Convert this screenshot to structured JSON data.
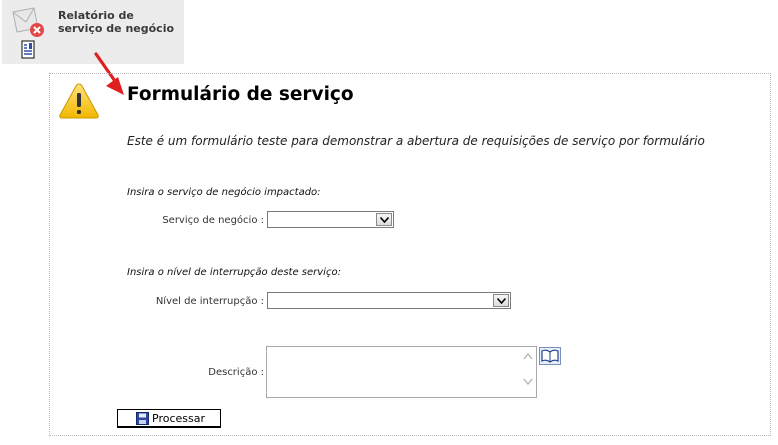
{
  "report": {
    "title": "Relatório de serviço de negócio"
  },
  "form": {
    "title": "Formulário de serviço",
    "description": "Este é um formulário teste para demonstrar a abertura de requisições de serviço por formulário",
    "service_section": "Insira o serviço de negócio impactado:",
    "service_label": "Serviço de negócio :",
    "service_value": "",
    "interruption_section": "Insira o nível de interrupção deste serviço:",
    "interruption_label": "Nível de interrupção :",
    "interruption_value": "",
    "description_label": "Descrição :",
    "description_value": "",
    "submit_label": "Processar"
  },
  "colors": {
    "arrow": "#e02020",
    "warning": "#f2c200",
    "panel_border": "#b8b8b8",
    "tile_background": "#ececec"
  },
  "icons": [
    "envelope-error-icon",
    "document-icon",
    "warning-icon",
    "dropdown-arrow-icon",
    "book-icon",
    "save-icon"
  ]
}
